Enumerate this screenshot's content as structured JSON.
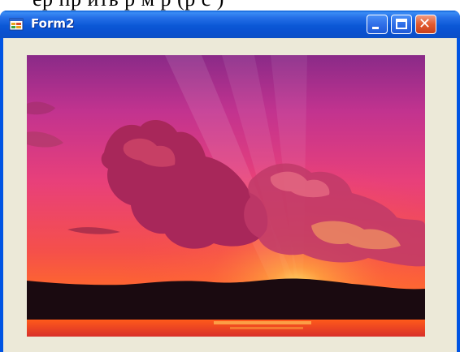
{
  "page_top_text": "ер пр ить р м р (р с )",
  "window": {
    "title": "Form2",
    "icons": {
      "app": "form-app-icon",
      "minimize": "minimize-icon",
      "maximize": "maximize-icon",
      "close": "close-icon"
    }
  },
  "picture": {
    "description_name": "sunset-image"
  }
}
